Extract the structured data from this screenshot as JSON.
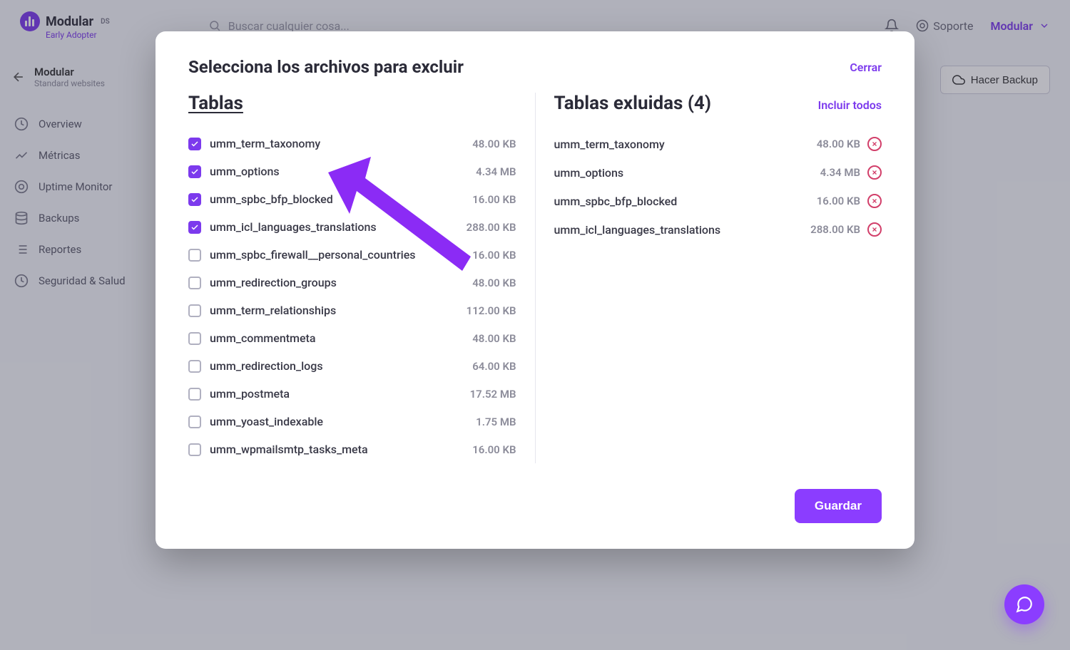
{
  "brand": {
    "name": "Modular",
    "os": "DS",
    "tagline": "Early Adopter"
  },
  "search": {
    "placeholder": "Buscar cualquier cosa..."
  },
  "topnav": {
    "support": "Soporte",
    "user": "Modular"
  },
  "breadcrumb": {
    "title": "Modular",
    "subtitle": "Standard websites"
  },
  "sidebar": {
    "items": [
      {
        "label": "Overview"
      },
      {
        "label": "Métricas"
      },
      {
        "label": "Uptime Monitor"
      },
      {
        "label": "Backups"
      },
      {
        "label": "Reportes"
      },
      {
        "label": "Seguridad & Salud"
      }
    ]
  },
  "page": {
    "backup_button": "Hacer Backup"
  },
  "modal": {
    "title": "Selecciona los archivos para excluir",
    "close": "Cerrar",
    "tables_title": "Tablas",
    "excluded_title": "Tablas exluidas (4)",
    "include_all": "Incluir todos",
    "save": "Guardar",
    "tables": [
      {
        "name": "umm_term_taxonomy",
        "size": "48.00 KB",
        "checked": true
      },
      {
        "name": "umm_options",
        "size": "4.34 MB",
        "checked": true
      },
      {
        "name": "umm_spbc_bfp_blocked",
        "size": "16.00 KB",
        "checked": true
      },
      {
        "name": "umm_icl_languages_translations",
        "size": "288.00 KB",
        "checked": true
      },
      {
        "name": "umm_spbc_firewall__personal_countries",
        "size": "16.00 KB",
        "checked": false
      },
      {
        "name": "umm_redirection_groups",
        "size": "48.00 KB",
        "checked": false
      },
      {
        "name": "umm_term_relationships",
        "size": "112.00 KB",
        "checked": false
      },
      {
        "name": "umm_commentmeta",
        "size": "48.00 KB",
        "checked": false
      },
      {
        "name": "umm_redirection_logs",
        "size": "64.00 KB",
        "checked": false
      },
      {
        "name": "umm_postmeta",
        "size": "17.52 MB",
        "checked": false
      },
      {
        "name": "umm_yoast_indexable",
        "size": "1.75 MB",
        "checked": false
      },
      {
        "name": "umm_wpmailsmtp_tasks_meta",
        "size": "16.00 KB",
        "checked": false
      }
    ],
    "excluded": [
      {
        "name": "umm_term_taxonomy",
        "size": "48.00 KB"
      },
      {
        "name": "umm_options",
        "size": "4.34 MB"
      },
      {
        "name": "umm_spbc_bfp_blocked",
        "size": "16.00 KB"
      },
      {
        "name": "umm_icl_languages_translations",
        "size": "288.00 KB"
      }
    ]
  }
}
